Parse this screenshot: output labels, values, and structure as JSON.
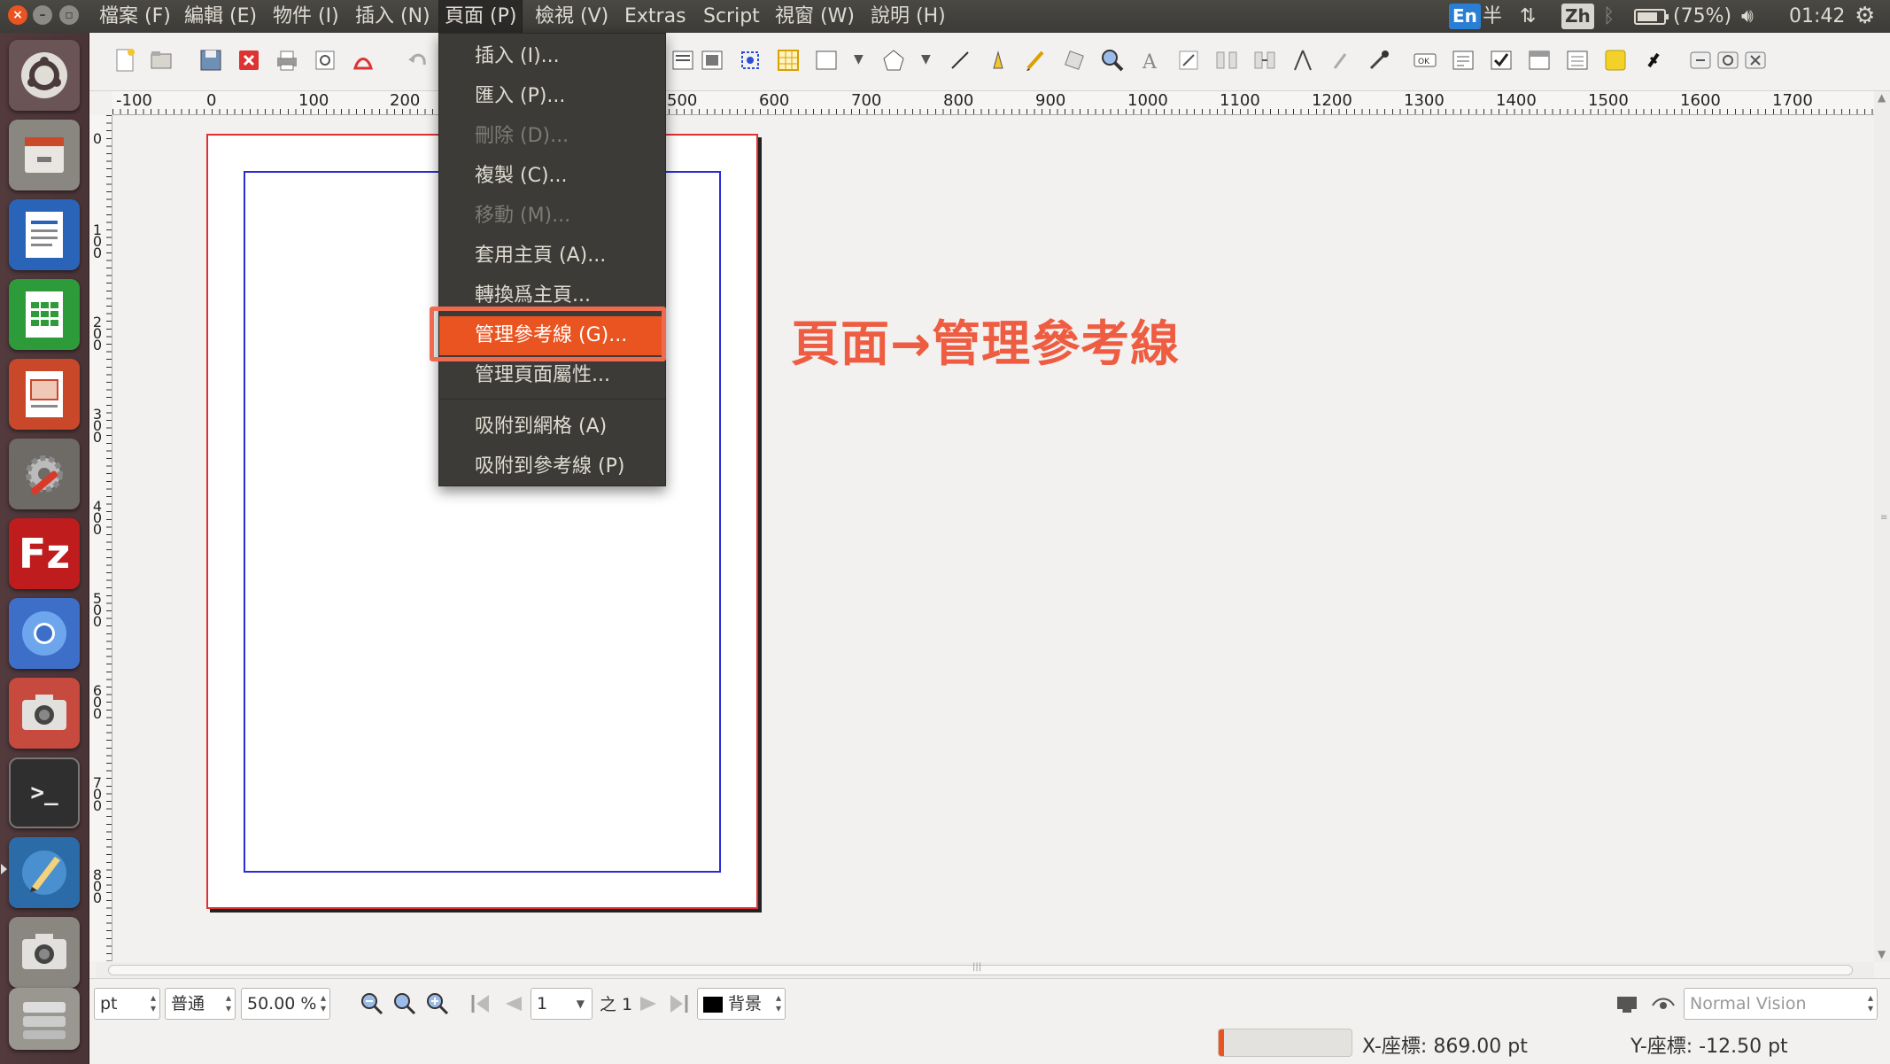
{
  "menubar": {
    "items": [
      "檔案 (F)",
      "編輯 (E)",
      "物件 (I)",
      "插入 (N)",
      "頁面 (P)",
      "檢視 (V)",
      "Extras",
      "Script",
      "視窗 (W)",
      "說明 (H)"
    ],
    "active_index": 4
  },
  "indicators": {
    "input_en": "En",
    "half_width": "半",
    "input_zh": "Zh",
    "battery": "(75%)",
    "clock": "01:42"
  },
  "page_menu": {
    "items": [
      {
        "label": "插入 (I)...",
        "enabled": true
      },
      {
        "label": "匯入 (P)...",
        "enabled": true
      },
      {
        "label": "刪除 (D)...",
        "enabled": false
      },
      {
        "label": "複製 (C)...",
        "enabled": true
      },
      {
        "label": "移動 (M)...",
        "enabled": false
      },
      {
        "label": "套用主頁 (A)...",
        "enabled": true
      },
      {
        "label": "轉換爲主頁...",
        "enabled": true
      },
      {
        "label": "管理參考線 (G)...",
        "enabled": true,
        "highlighted": true
      },
      {
        "label": "管理頁面屬性...",
        "enabled": true
      },
      {
        "label": "吸附到網格 (A)",
        "enabled": true
      },
      {
        "label": "吸附到參考線 (P)",
        "enabled": true
      }
    ]
  },
  "annotation": "頁面→管理參考線",
  "ruler": {
    "h_labels": [
      "-100",
      "0",
      "100",
      "200",
      "500",
      "600",
      "700",
      "800",
      "900",
      "1000",
      "1100",
      "1200",
      "1300",
      "1400",
      "1500",
      "1600",
      "1700"
    ],
    "v_labels": [
      "0",
      "100",
      "200",
      "300",
      "400",
      "500",
      "600",
      "700",
      "800"
    ]
  },
  "bottom": {
    "unit": "pt",
    "mode": "普通",
    "zoom": "50.00 %",
    "page_number": "1",
    "page_total": "之 1",
    "layer": "背景",
    "vision": "Normal Vision",
    "x_coord": "X-座標: 869.00 pt",
    "y_coord": "Y-座標: -12.50 pt"
  },
  "colors": {
    "accent": "#e95420",
    "annotation": "#ee5c42",
    "page_border": "#e03030",
    "margin_guide": "#2b2bd6"
  },
  "launcher_icons": [
    "ubuntu-dash-icon",
    "files-icon",
    "writer-icon",
    "calc-icon",
    "impress-icon",
    "settings-icon",
    "filezilla-icon",
    "chromium-icon",
    "camera-icon",
    "terminal-icon",
    "scribus-icon",
    "camera2-icon",
    "drives-icon"
  ]
}
